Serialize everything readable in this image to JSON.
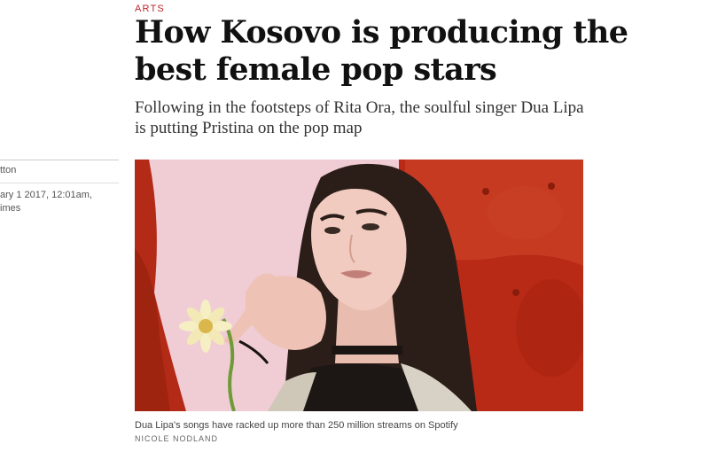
{
  "article": {
    "section": "ARTS",
    "headline": "How Kosovo is producing the best female pop stars",
    "standfirst": "Following in the footsteps of Rita Ora, the soulful singer Dua Lipa is putting Pristina on the pop map"
  },
  "byline": {
    "author": "tton",
    "date_line1": "ary 1 2017, 12:01am,",
    "date_line2": "imes"
  },
  "image": {
    "caption": "Dua Lipa's songs have racked up more than 250 million streams on Spotify",
    "credit": "NICOLE NODLAND"
  },
  "colors": {
    "section_label": "#b8262c",
    "backdrop_pink": "#ecc5cd",
    "sofa_red": "#b82a16"
  }
}
